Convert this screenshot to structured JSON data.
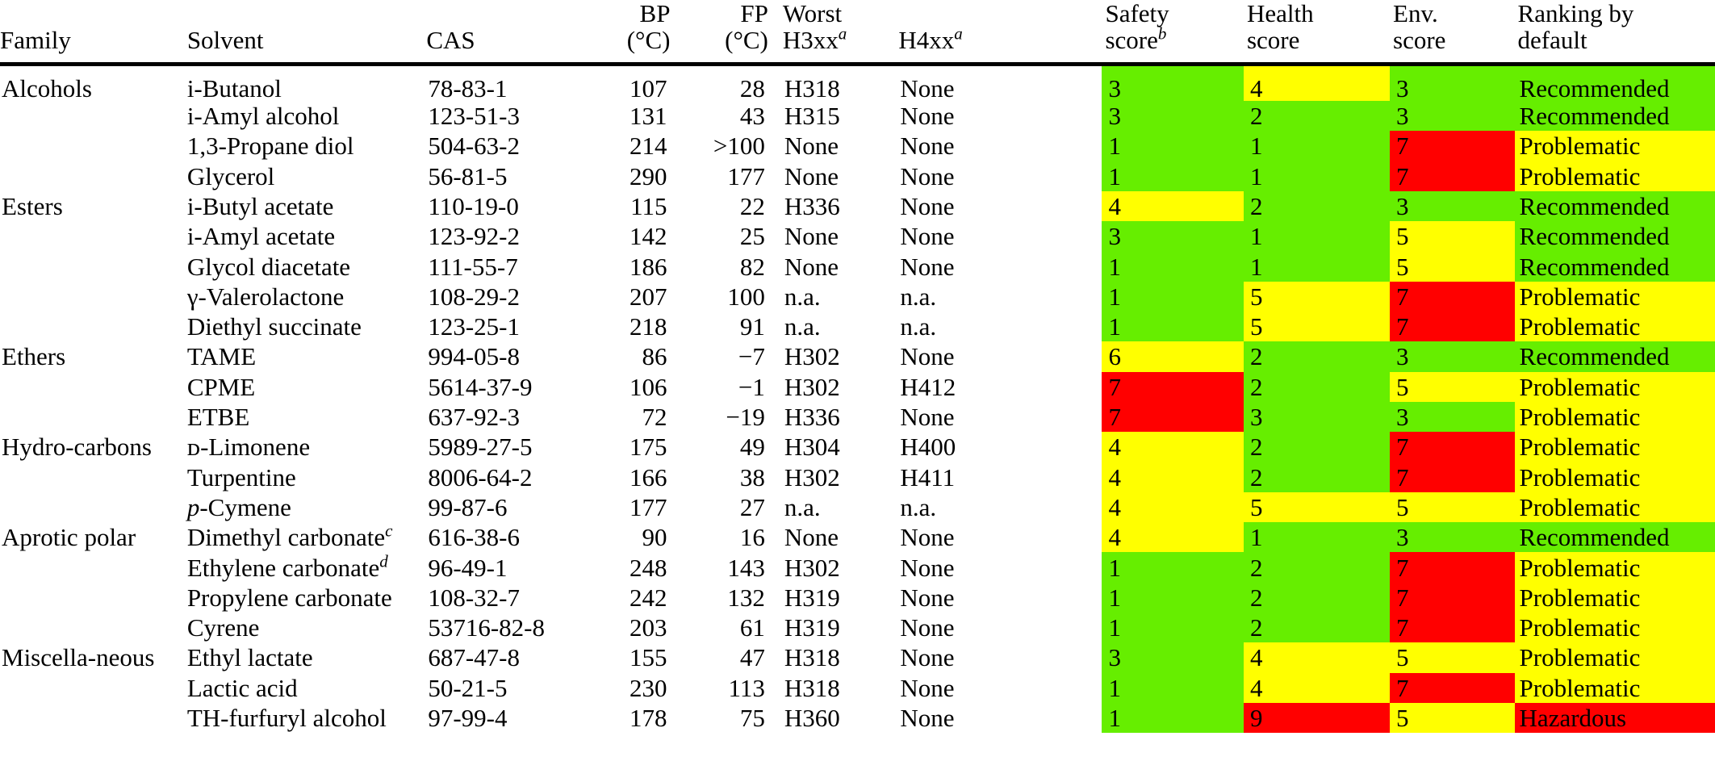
{
  "colors": {
    "green": "#66EE00",
    "yellow": "#FFFF00",
    "red": "#FF0000",
    "white": "#FFFFFF",
    "text": "#000000"
  },
  "header": {
    "columns": [
      {
        "id": "family",
        "line1": "",
        "line2": "Family",
        "sup": ""
      },
      {
        "id": "solvent",
        "line1": "",
        "line2": "Solvent",
        "sup": ""
      },
      {
        "id": "cas",
        "line1": "",
        "line2": "CAS",
        "sup": ""
      },
      {
        "id": "bp",
        "line1": "BP",
        "line2": "(°C)",
        "sup": ""
      },
      {
        "id": "fp",
        "line1": "FP",
        "line2": "(°C)",
        "sup": ""
      },
      {
        "id": "h3xx",
        "line1": "Worst",
        "line2": "H3xx",
        "sup": "a"
      },
      {
        "id": "h4xx",
        "line1": "",
        "line2": "H4xx",
        "sup": "a"
      },
      {
        "id": "safety",
        "line1": "Safety",
        "line2": "score",
        "sup": "b"
      },
      {
        "id": "health",
        "line1": "Health",
        "line2": "score",
        "sup": ""
      },
      {
        "id": "env",
        "line1": "Env.",
        "line2": "score",
        "sup": ""
      },
      {
        "id": "rank",
        "line1": "Ranking by",
        "line2": "default",
        "sup": ""
      }
    ]
  },
  "chart_data": {
    "type": "table",
    "title": "Solvent selection guide — safety, health and environmental scores",
    "columns": [
      "Family",
      "Solvent",
      "CAS",
      "BP (°C)",
      "FP (°C)",
      "Worst H3xx",
      "H4xx",
      "Safety score",
      "Health score",
      "Env. score",
      "Ranking by default"
    ],
    "rows": [
      {
        "family": "Alcohols",
        "solvent": "i-Butanol",
        "cas": "78-83-1",
        "bp": "107",
        "fp": "28",
        "h3xx": "H318",
        "h4xx": "None",
        "safety": "3",
        "safety_color": "green",
        "health": "4",
        "health_color": "yellow",
        "env": "3",
        "env_color": "green",
        "rank": "Recommended",
        "rank_color": "green"
      },
      {
        "family": "",
        "solvent": "i-Amyl alcohol",
        "cas": "123-51-3",
        "bp": "131",
        "fp": "43",
        "h3xx": "H315",
        "h4xx": "None",
        "safety": "3",
        "safety_color": "green",
        "health": "2",
        "health_color": "green",
        "env": "3",
        "env_color": "green",
        "rank": "Recommended",
        "rank_color": "green"
      },
      {
        "family": "",
        "solvent": "1,3-Propane diol",
        "cas": "504-63-2",
        "bp": "214",
        "fp": ">100",
        "h3xx": "None",
        "h4xx": "None",
        "safety": "1",
        "safety_color": "green",
        "health": "1",
        "health_color": "green",
        "env": "7",
        "env_color": "red",
        "rank": "Problematic",
        "rank_color": "yellow"
      },
      {
        "family": "",
        "solvent": "Glycerol",
        "cas": "56-81-5",
        "bp": "290",
        "fp": "177",
        "h3xx": "None",
        "h4xx": "None",
        "safety": "1",
        "safety_color": "green",
        "health": "1",
        "health_color": "green",
        "env": "7",
        "env_color": "red",
        "rank": "Problematic",
        "rank_color": "yellow"
      },
      {
        "family": "Esters",
        "solvent": "i-Butyl acetate",
        "cas": "110-19-0",
        "bp": "115",
        "fp": "22",
        "h3xx": "H336",
        "h4xx": "None",
        "safety": "4",
        "safety_color": "yellow",
        "health": "2",
        "health_color": "green",
        "env": "3",
        "env_color": "green",
        "rank": "Recommended",
        "rank_color": "green"
      },
      {
        "family": "",
        "solvent": "i-Amyl acetate",
        "cas": "123-92-2",
        "bp": "142",
        "fp": "25",
        "h3xx": "None",
        "h4xx": "None",
        "safety": "3",
        "safety_color": "green",
        "health": "1",
        "health_color": "green",
        "env": "5",
        "env_color": "yellow",
        "rank": "Recommended",
        "rank_color": "green"
      },
      {
        "family": "",
        "solvent": "Glycol diacetate",
        "cas": "111-55-7",
        "bp": "186",
        "fp": "82",
        "h3xx": "None",
        "h4xx": "None",
        "safety": "1",
        "safety_color": "green",
        "health": "1",
        "health_color": "green",
        "env": "5",
        "env_color": "yellow",
        "rank": "Recommended",
        "rank_color": "green"
      },
      {
        "family": "",
        "solvent": "γ-Valerolactone",
        "cas": "108-29-2",
        "bp": "207",
        "fp": "100",
        "h3xx": "n.a.",
        "h4xx": "n.a.",
        "safety": "1",
        "safety_color": "green",
        "health": "5",
        "health_color": "yellow",
        "env": "7",
        "env_color": "red",
        "rank": "Problematic",
        "rank_color": "yellow"
      },
      {
        "family": "",
        "solvent": "Diethyl succinate",
        "cas": "123-25-1",
        "bp": "218",
        "fp": "91",
        "h3xx": "n.a.",
        "h4xx": "n.a.",
        "safety": "1",
        "safety_color": "green",
        "health": "5",
        "health_color": "yellow",
        "env": "7",
        "env_color": "red",
        "rank": "Problematic",
        "rank_color": "yellow"
      },
      {
        "family": "Ethers",
        "solvent": "TAME",
        "cas": "994-05-8",
        "bp": "86",
        "fp": "−7",
        "h3xx": "H302",
        "h4xx": "None",
        "safety": "6",
        "safety_color": "yellow",
        "health": "2",
        "health_color": "green",
        "env": "3",
        "env_color": "green",
        "rank": "Recommended",
        "rank_color": "green"
      },
      {
        "family": "",
        "solvent": "CPME",
        "cas": "5614-37-9",
        "bp": "106",
        "fp": "−1",
        "h3xx": "H302",
        "h4xx": "H412",
        "safety": "7",
        "safety_color": "red",
        "health": "2",
        "health_color": "green",
        "env": "5",
        "env_color": "yellow",
        "rank": "Problematic",
        "rank_color": "yellow"
      },
      {
        "family": "",
        "solvent": "ETBE",
        "cas": "637-92-3",
        "bp": "72",
        "fp": "−19",
        "h3xx": "H336",
        "h4xx": "None",
        "safety": "7",
        "safety_color": "red",
        "health": "3",
        "health_color": "green",
        "env": "3",
        "env_color": "green",
        "rank": "Problematic",
        "rank_color": "yellow"
      },
      {
        "family": "Hydro-carbons",
        "solvent": "ᴅ-Limonene",
        "cas": "5989-27-5",
        "bp": "175",
        "fp": "49",
        "h3xx": "H304",
        "h4xx": "H400",
        "safety": "4",
        "safety_color": "yellow",
        "health": "2",
        "health_color": "green",
        "env": "7",
        "env_color": "red",
        "rank": "Problematic",
        "rank_color": "yellow"
      },
      {
        "family": "",
        "solvent": "Turpentine",
        "cas": "8006-64-2",
        "bp": "166",
        "fp": "38",
        "h3xx": "H302",
        "h4xx": "H411",
        "safety": "4",
        "safety_color": "yellow",
        "health": "2",
        "health_color": "green",
        "env": "7",
        "env_color": "red",
        "rank": "Problematic",
        "rank_color": "yellow"
      },
      {
        "family": "",
        "solvent": "p-Cymene",
        "solvent_italic_prefix": "p",
        "cas": "99-87-6",
        "bp": "177",
        "fp": "27",
        "h3xx": "n.a.",
        "h4xx": "n.a.",
        "safety": "4",
        "safety_color": "yellow",
        "health": "5",
        "health_color": "yellow",
        "env": "5",
        "env_color": "yellow",
        "rank": "Problematic",
        "rank_color": "yellow"
      },
      {
        "family": "Aprotic polar",
        "solvent": "Dimethyl carbonate",
        "solvent_sup": "c",
        "cas": "616-38-6",
        "bp": "90",
        "fp": "16",
        "h3xx": "None",
        "h4xx": "None",
        "safety": "4",
        "safety_color": "yellow",
        "health": "1",
        "health_color": "green",
        "env": "3",
        "env_color": "green",
        "rank": "Recommended",
        "rank_color": "green"
      },
      {
        "family": "",
        "solvent": "Ethylene carbonate",
        "solvent_sup": "d",
        "cas": "96-49-1",
        "bp": "248",
        "fp": "143",
        "h3xx": "H302",
        "h4xx": "None",
        "safety": "1",
        "safety_color": "green",
        "health": "2",
        "health_color": "green",
        "env": "7",
        "env_color": "red",
        "rank": "Problematic",
        "rank_color": "yellow"
      },
      {
        "family": "",
        "solvent": "Propylene carbonate",
        "cas": "108-32-7",
        "bp": "242",
        "fp": "132",
        "h3xx": "H319",
        "h4xx": "None",
        "safety": "1",
        "safety_color": "green",
        "health": "2",
        "health_color": "green",
        "env": "7",
        "env_color": "red",
        "rank": "Problematic",
        "rank_color": "yellow"
      },
      {
        "family": "",
        "solvent": "Cyrene",
        "cas": "53716-82-8",
        "bp": "203",
        "fp": "61",
        "h3xx": "H319",
        "h4xx": "None",
        "safety": "1",
        "safety_color": "green",
        "health": "2",
        "health_color": "green",
        "env": "7",
        "env_color": "red",
        "rank": "Problematic",
        "rank_color": "yellow"
      },
      {
        "family": "Miscella-neous",
        "solvent": "Ethyl lactate",
        "cas": "687-47-8",
        "bp": "155",
        "fp": "47",
        "h3xx": "H318",
        "h4xx": "None",
        "safety": "3",
        "safety_color": "green",
        "health": "4",
        "health_color": "yellow",
        "env": "5",
        "env_color": "yellow",
        "rank": "Problematic",
        "rank_color": "yellow"
      },
      {
        "family": "",
        "solvent": "Lactic acid",
        "cas": "50-21-5",
        "bp": "230",
        "fp": "113",
        "h3xx": "H318",
        "h4xx": "None",
        "safety": "1",
        "safety_color": "green",
        "health": "4",
        "health_color": "yellow",
        "env": "7",
        "env_color": "red",
        "rank": "Problematic",
        "rank_color": "yellow"
      },
      {
        "family": "",
        "solvent": "TH-furfuryl alcohol",
        "cas": "97-99-4",
        "bp": "178",
        "fp": "75",
        "h3xx": "H360",
        "h4xx": "None",
        "safety": "1",
        "safety_color": "green",
        "health": "9",
        "health_color": "red",
        "env": "5",
        "env_color": "yellow",
        "rank": "Hazardous",
        "rank_color": "red"
      }
    ]
  }
}
